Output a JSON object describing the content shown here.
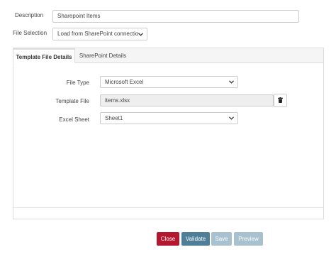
{
  "form": {
    "description_label": "Description",
    "description_value": "Sharepoint Items",
    "file_selection_label": "File Selection",
    "file_selection_value": "Load from SharePoint connectio"
  },
  "tabs": [
    {
      "label": "Template File Details",
      "active": true
    },
    {
      "label": "SharePoint Details",
      "active": false
    }
  ],
  "template": {
    "file_type_label": "File Type",
    "file_type_value": "Microsoft Excel",
    "template_file_label": "Template File",
    "template_file_value": "items.xlsx",
    "excel_sheet_label": "Excel Sheet",
    "excel_sheet_value": "Sheet1"
  },
  "buttons": {
    "close": "Close",
    "validate": "Validate",
    "save": "Save",
    "preview": "Preview"
  },
  "colors": {
    "close": "#b5172e",
    "validate": "#4f7f98",
    "disabled": "#a7c1cf"
  },
  "icons": {
    "select_chevron": "chevron-down-icon",
    "delete": "trash-icon"
  }
}
